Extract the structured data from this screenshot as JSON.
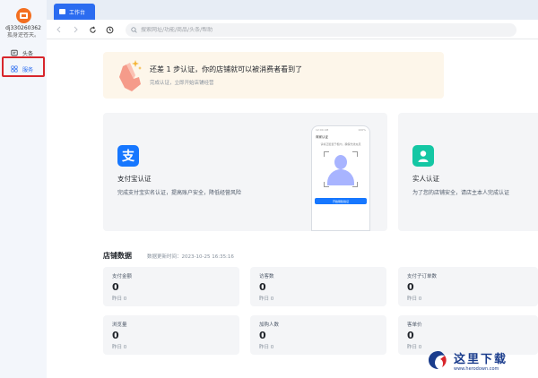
{
  "user": {
    "name": "dj330260362",
    "motto": "孤身逆苍天。"
  },
  "sidebar": {
    "items": [
      {
        "label": "头条",
        "icon": "headlines-icon"
      },
      {
        "label": "服务",
        "icon": "grid-icon"
      }
    ]
  },
  "tabs": [
    {
      "label": "工作台",
      "icon": "home-icon"
    }
  ],
  "toolbar": {
    "search_placeholder": "搜索网址/功能/商品/头条/帮助"
  },
  "banner": {
    "title": "还差 1 步认证，你的店铺就可以被消费者看到了",
    "subtitle": "完成认证，立即开始店铺经营"
  },
  "cards": {
    "alipay": {
      "title": "支付宝认证",
      "desc": "完成支付宝实名认证，提高账户安全，降低经营风险",
      "icon_char": "支"
    },
    "phone": {
      "status_left": "12:00 AM",
      "status_right": "100%",
      "header": "商家认证",
      "tip": "请将正脸置于框内，确保光线充足",
      "button": "开始刷脸验证"
    },
    "real": {
      "title": "实人认证",
      "desc": "为了您的店铺安全，请店主本人完成认证"
    }
  },
  "store": {
    "title": "店铺数据",
    "updated": "数据更新时间：2023-10-25 16:35:16",
    "stats": [
      {
        "label": "支付金额",
        "value": "0",
        "yesterday": "昨日 0"
      },
      {
        "label": "访客数",
        "value": "0",
        "yesterday": "昨日 0"
      },
      {
        "label": "支付子订单数",
        "value": "0",
        "yesterday": "昨日 0"
      },
      {
        "label": "浏览量",
        "value": "0",
        "yesterday": "昨日 0"
      },
      {
        "label": "加购人数",
        "value": "0",
        "yesterday": "昨日 0"
      },
      {
        "label": "客单价",
        "value": "0",
        "yesterday": "昨日 0"
      }
    ]
  },
  "watermark": {
    "name": "这里下载",
    "url": "www.herodown.com"
  },
  "colors": {
    "accent": "#2b6cf0",
    "alipay": "#1677ff",
    "real": "#14c7a4",
    "highlight": "#d8262c",
    "banner_bg": "#fdf6ea"
  }
}
